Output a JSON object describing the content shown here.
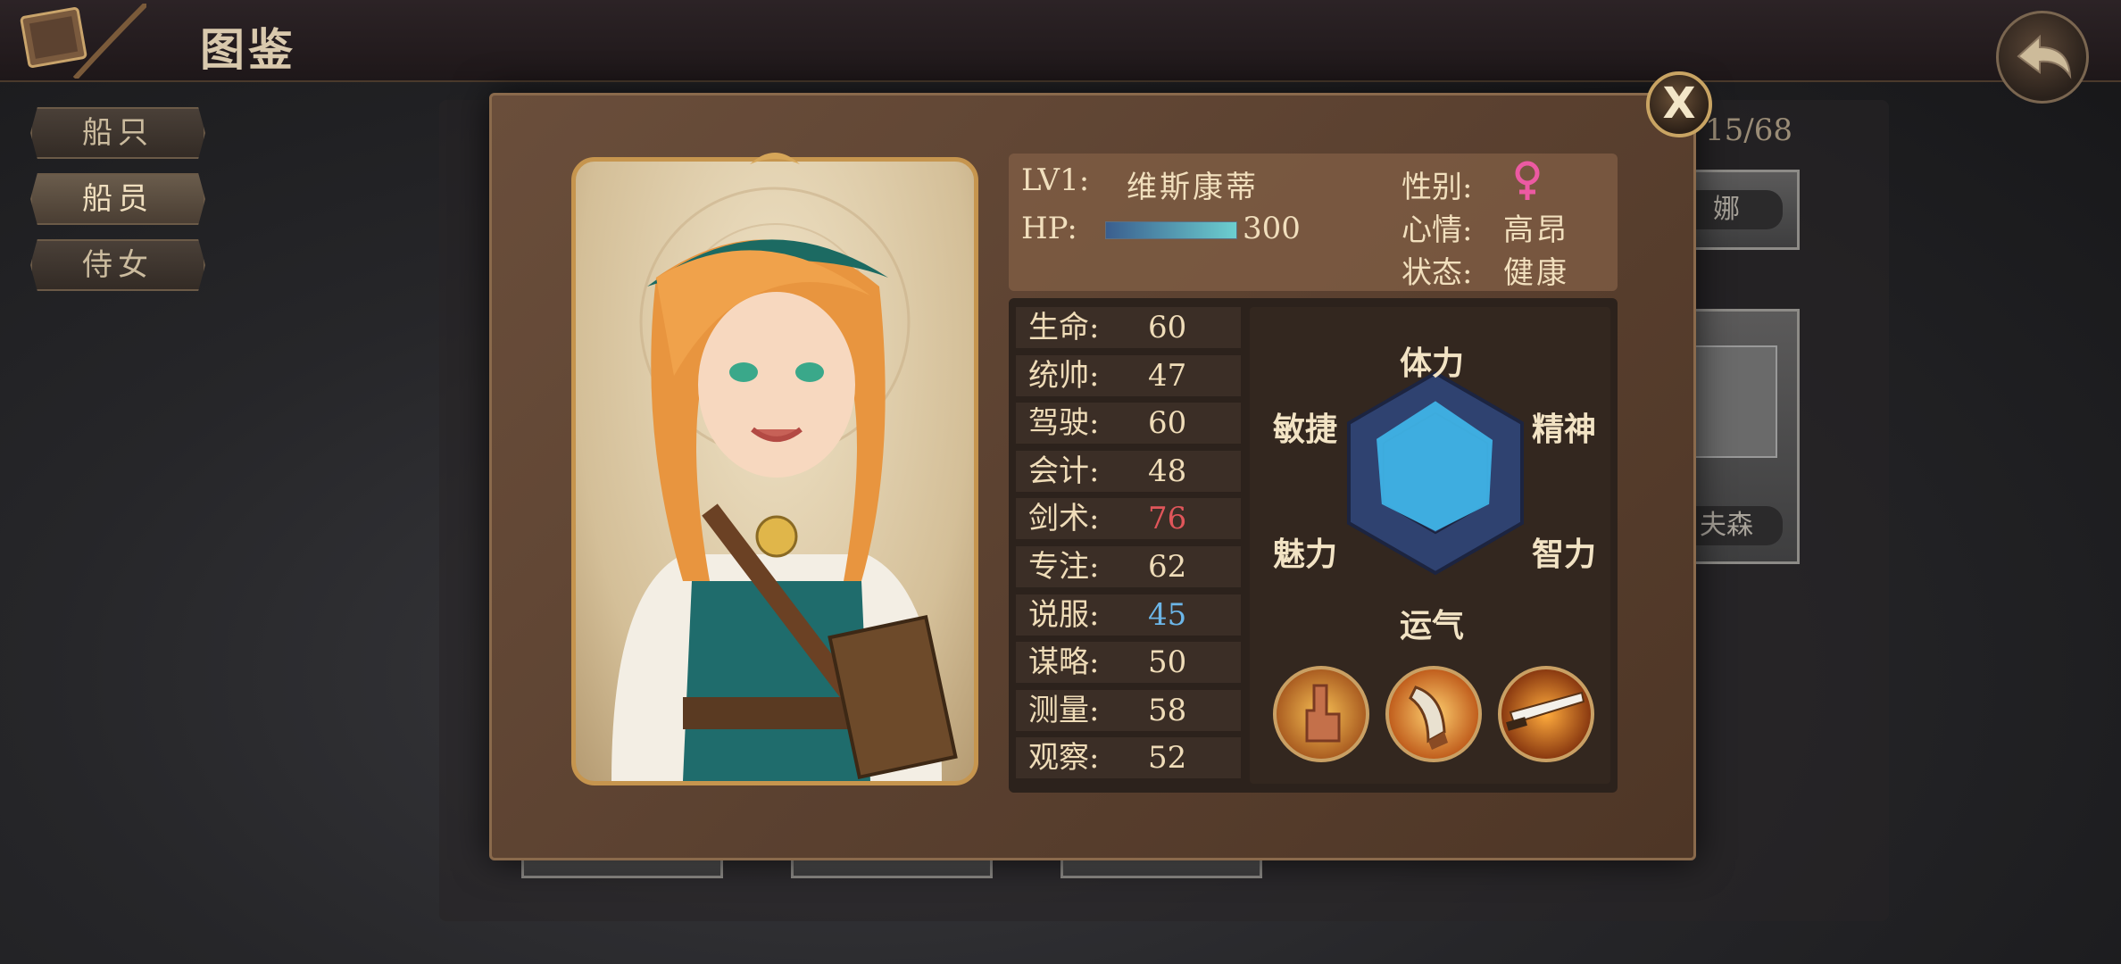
{
  "header": {
    "title": "图鉴"
  },
  "side_tabs": [
    "船只",
    "船员",
    "侍女"
  ],
  "background_list": {
    "counter": "15/68",
    "card_names": [
      "娜",
      "夫森"
    ]
  },
  "modal": {
    "close_label": "X",
    "character": {
      "level_label": "LV1:",
      "name": "维斯康蒂",
      "hp_label": "HP:",
      "hp_value": "300",
      "hp_fraction": 1.0,
      "gender_label": "性别:",
      "gender_icon": "female-symbol-icon",
      "mood_label": "心情:",
      "mood_value": "高昂",
      "status_label": "状态:",
      "status_value": "健康"
    },
    "stats": [
      {
        "label": "生命:",
        "value": "60",
        "color": "#efdcb8"
      },
      {
        "label": "统帅:",
        "value": "47",
        "color": "#efdcb8"
      },
      {
        "label": "驾驶:",
        "value": "60",
        "color": "#efdcb8"
      },
      {
        "label": "会计:",
        "value": "48",
        "color": "#efdcb8"
      },
      {
        "label": "剑术:",
        "value": "76",
        "color": "#e0565a"
      },
      {
        "label": "专注:",
        "value": "62",
        "color": "#efdcb8"
      },
      {
        "label": "说服:",
        "value": "45",
        "color": "#6cb6e8"
      },
      {
        "label": "谋略:",
        "value": "50",
        "color": "#efdcb8"
      },
      {
        "label": "测量:",
        "value": "58",
        "color": "#efdcb8"
      },
      {
        "label": "观察:",
        "value": "52",
        "color": "#efdcb8"
      }
    ],
    "radar": {
      "labels": [
        "体力",
        "精神",
        "智力",
        "运气",
        "魅力",
        "敏捷"
      ],
      "values": [
        0.72,
        0.66,
        0.62,
        0.58,
        0.62,
        0.68
      ],
      "fill_color": "#3fb3e6"
    },
    "skills": [
      "hand-gesture-icon",
      "horn-blast-icon",
      "blade-strike-icon"
    ]
  }
}
